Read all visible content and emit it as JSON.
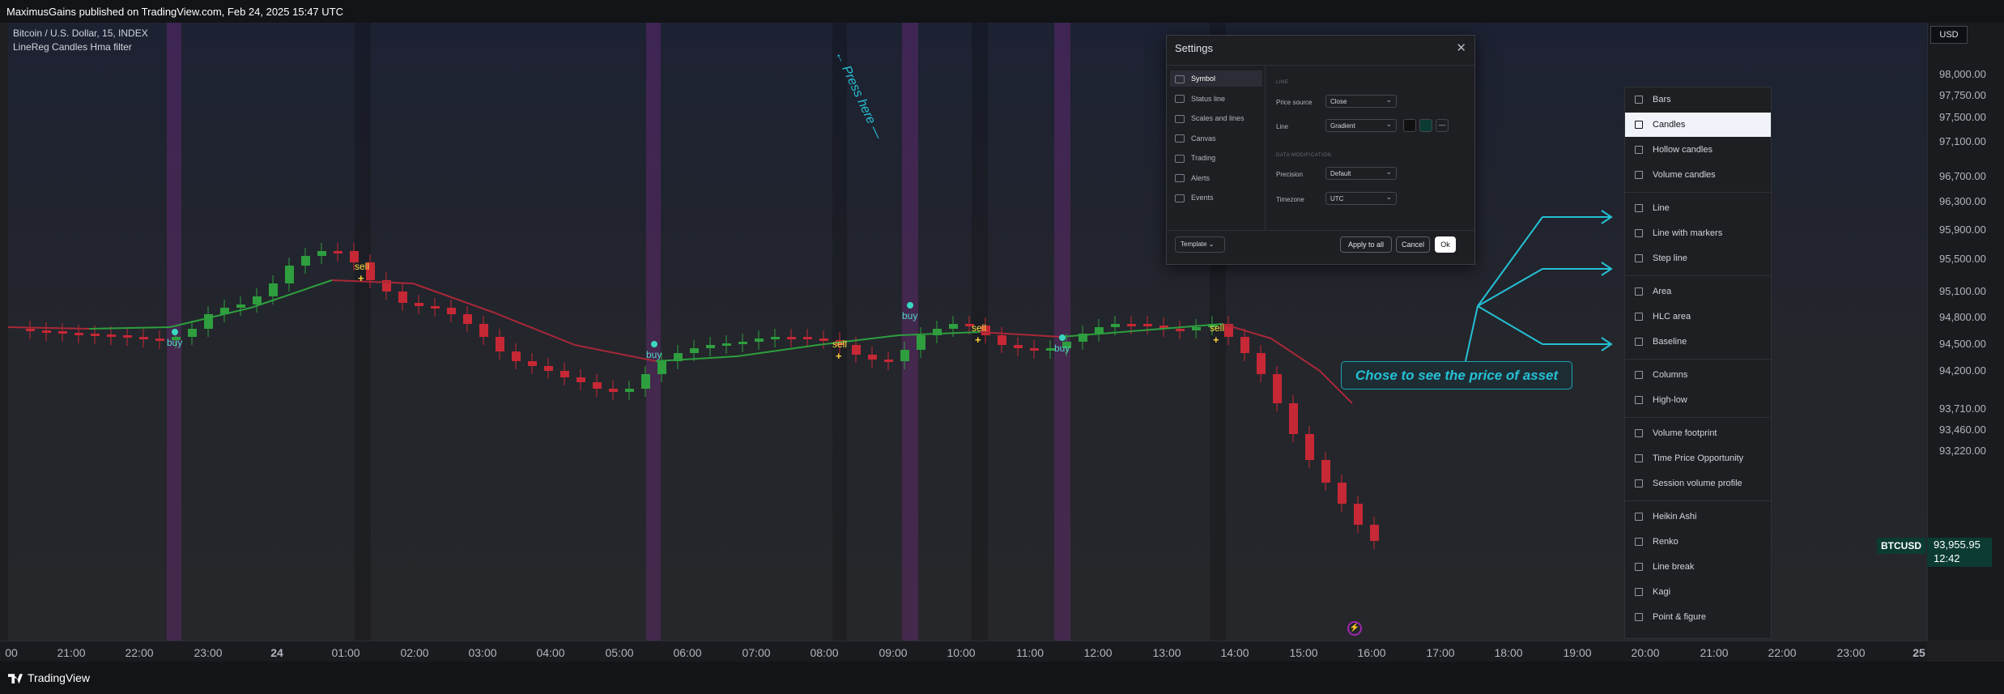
{
  "topbar": {
    "text": "MaximusGains published on TradingView.com, Feb 24, 2025 15:47 UTC"
  },
  "legend": {
    "symbol": "Bitcoin / U.S. Dollar, 15, INDEX",
    "indicator": "LineReg Candles Hma filter"
  },
  "price_axis": {
    "currency": "USD",
    "labels": [
      "98,000.00",
      "97,750.00",
      "97,500.00",
      "97,100.00",
      "96,700.00",
      "96,300.00",
      "95,900.00",
      "95,500.00",
      "95,100.00",
      "94,800.00",
      "94,500.00",
      "94,200.00",
      "93,710.00",
      "93,460.00",
      "93,220.00"
    ],
    "symbol_tag": "BTCUSD",
    "last_price": "93,955.95",
    "countdown": "12:42"
  },
  "time_axis": {
    "labels": [
      "00",
      "21:00",
      "22:00",
      "23:00",
      "24",
      "01:00",
      "02:00",
      "03:00",
      "04:00",
      "05:00",
      "06:00",
      "07:00",
      "08:00",
      "09:00",
      "10:00",
      "11:00",
      "12:00",
      "13:00",
      "14:00",
      "15:00",
      "16:00",
      "17:00",
      "18:00",
      "19:00",
      "20:00",
      "21:00",
      "22:00",
      "23:00",
      "25"
    ]
  },
  "signals": {
    "buy": "buy",
    "sell": "sell"
  },
  "annotations": {
    "press_here": "Press here",
    "chose_box": "Chose to see the price of asset"
  },
  "settings": {
    "title": "Settings",
    "close": "✕",
    "nav": [
      "Symbol",
      "Status line",
      "Scales and lines",
      "Canvas",
      "Trading",
      "Alerts",
      "Events"
    ],
    "section_chart": "LINE",
    "price_source_label": "Price source",
    "price_source_value": "Close",
    "line_label": "Line",
    "line_value": "Gradient",
    "section_data": "DATA MODIFICATION",
    "precision_label": "Precision",
    "precision_value": "Default",
    "timezone_label": "Timezone",
    "timezone_value": "UTC",
    "template_label": "Template",
    "apply_label": "Apply to all",
    "cancel_label": "Cancel",
    "ok_label": "Ok"
  },
  "chart_type_menu": {
    "items": [
      "Bars",
      "Candles",
      "Hollow candles",
      "Volume candles",
      "Line",
      "Line with markers",
      "Step line",
      "Area",
      "HLC area",
      "Baseline",
      "Columns",
      "High-low",
      "Volume footprint",
      "Time Price Opportunity",
      "Session volume profile",
      "Heikin Ashi",
      "Renko",
      "Line break",
      "Kagi",
      "Point & figure"
    ],
    "selected": "Candles"
  },
  "footer": {
    "brand": "TradingView"
  },
  "colors": {
    "up": "#2e9e3e",
    "down": "#c62835",
    "accent": "#25c0d4",
    "signal_band": "#b432c8"
  }
}
